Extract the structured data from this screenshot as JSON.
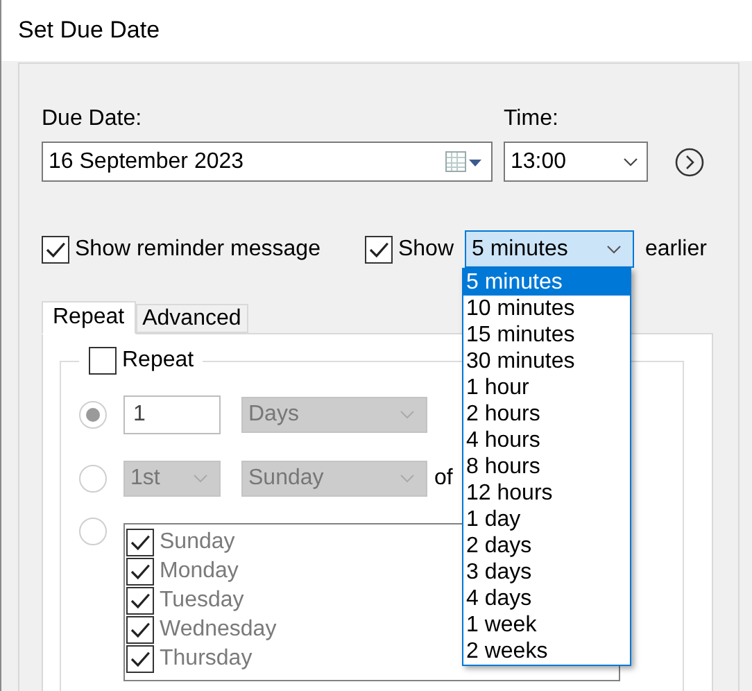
{
  "window": {
    "title": "Set Due Date"
  },
  "due_date": {
    "label": "Due Date:",
    "value": "16 September 2023"
  },
  "time": {
    "label": "Time:",
    "value": "13:00"
  },
  "reminder": {
    "label": "Show reminder message",
    "checked": true
  },
  "show": {
    "label": "Show",
    "checked": true,
    "value": "5 minutes",
    "suffix": "earlier",
    "expanded": true,
    "options": [
      {
        "label": "5 minutes",
        "selected": true
      },
      {
        "label": "10 minutes",
        "selected": false
      },
      {
        "label": "15 minutes",
        "selected": false
      },
      {
        "label": "30 minutes",
        "selected": false
      },
      {
        "label": "1 hour",
        "selected": false
      },
      {
        "label": "2 hours",
        "selected": false
      },
      {
        "label": "4 hours",
        "selected": false
      },
      {
        "label": "8 hours",
        "selected": false
      },
      {
        "label": "12 hours",
        "selected": false
      },
      {
        "label": "1 day",
        "selected": false
      },
      {
        "label": "2 days",
        "selected": false
      },
      {
        "label": "3 days",
        "selected": false
      },
      {
        "label": "4 days",
        "selected": false
      },
      {
        "label": "1 week",
        "selected": false
      },
      {
        "label": "2 weeks",
        "selected": false
      }
    ]
  },
  "tabs": [
    {
      "label": "Repeat",
      "selected": true
    },
    {
      "label": "Advanced",
      "selected": false
    }
  ],
  "repeat": {
    "label": "Repeat",
    "checked": false,
    "rows": [
      {
        "kind": "interval",
        "selected": true,
        "value": "1",
        "unit": "Days"
      },
      {
        "kind": "monthly",
        "selected": false,
        "ordinal": "1st",
        "day": "Sunday",
        "suffix": "of"
      },
      {
        "kind": "weekdays",
        "selected": false,
        "days": [
          {
            "label": "Sunday",
            "checked": true
          },
          {
            "label": "Monday",
            "checked": true
          },
          {
            "label": "Tuesday",
            "checked": true
          },
          {
            "label": "Wednesday",
            "checked": true
          },
          {
            "label": "Thursday",
            "checked": true
          }
        ]
      }
    ]
  }
}
